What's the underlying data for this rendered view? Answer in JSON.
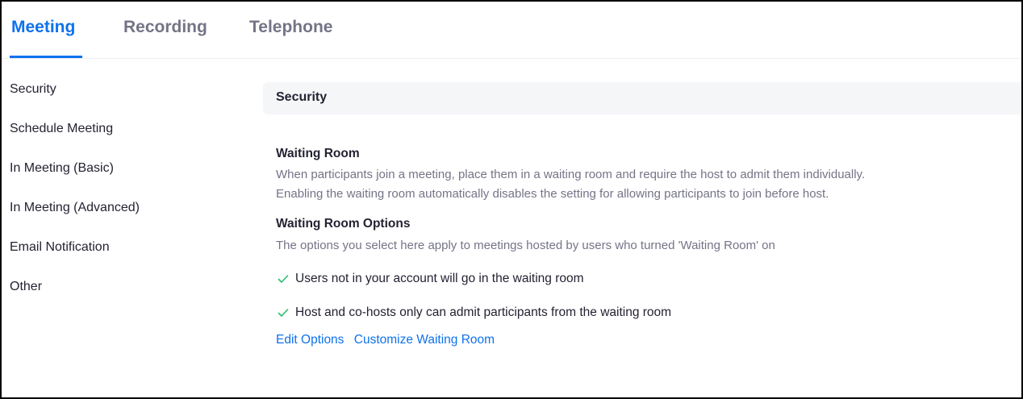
{
  "tabs": [
    {
      "label": "Meeting",
      "active": true
    },
    {
      "label": "Recording",
      "active": false
    },
    {
      "label": "Telephone",
      "active": false
    }
  ],
  "sidebar": {
    "items": [
      {
        "label": "Security"
      },
      {
        "label": "Schedule Meeting"
      },
      {
        "label": "In Meeting (Basic)"
      },
      {
        "label": "In Meeting (Advanced)"
      },
      {
        "label": "Email Notification"
      },
      {
        "label": "Other"
      }
    ]
  },
  "section": {
    "title": "Security"
  },
  "waiting_room": {
    "title": "Waiting Room",
    "description_line1": "When participants join a meeting, place them in a waiting room and require the host to admit them individually.",
    "description_line2": "Enabling the waiting room automatically disables the setting for allowing participants to join before host."
  },
  "waiting_room_options": {
    "title": "Waiting Room Options",
    "description": "The options you select here apply to meetings hosted by users who turned 'Waiting Room' on",
    "options": [
      {
        "label": "Users not in your account will go in the waiting room",
        "icon": "check-icon"
      },
      {
        "label": "Host and co-hosts only can admit participants from the waiting room",
        "icon": "check-icon"
      }
    ],
    "links": {
      "edit_options": "Edit Options",
      "customize": "Customize Waiting Room"
    }
  },
  "colors": {
    "accent": "#0e72ed",
    "text": "#232333",
    "muted": "#747487",
    "header_bg": "#f5f6f8",
    "check": "#2dbb6e"
  }
}
